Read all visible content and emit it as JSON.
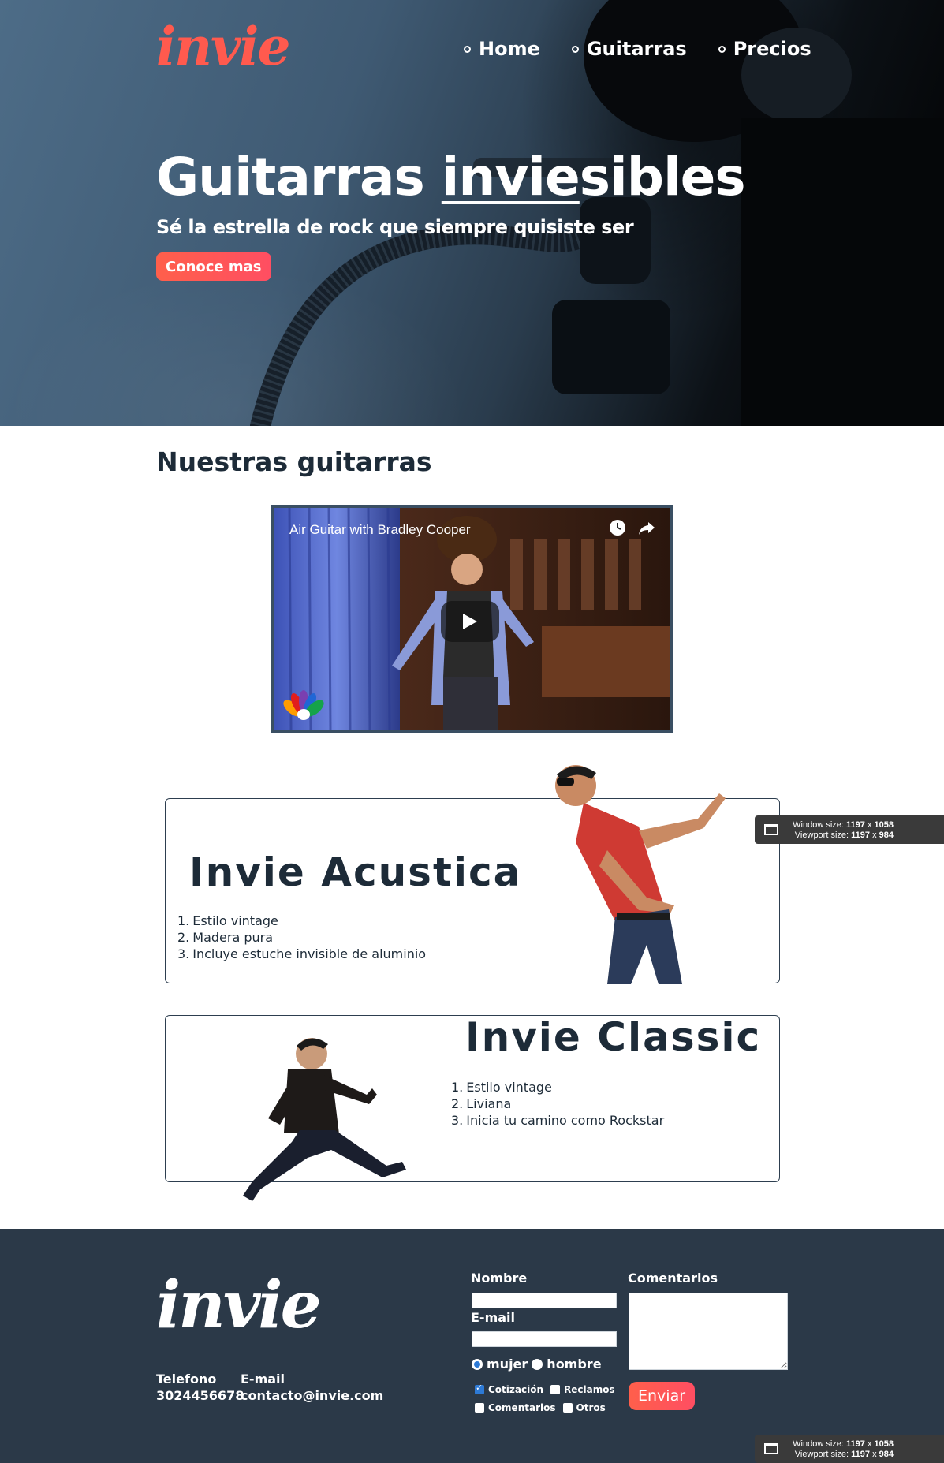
{
  "header": {
    "logo": "invie",
    "nav": [
      {
        "label": "Home"
      },
      {
        "label": "Guitarras"
      },
      {
        "label": "Precios"
      }
    ]
  },
  "hero": {
    "title_part1": "Guitarras ",
    "title_part2": "invie",
    "title_part3": "sibles",
    "subtitle": "Sé la estrella de rock que siempre quisiste ser",
    "cta_label": "Conoce mas"
  },
  "guitars_section": {
    "title": "Nuestras guitarras",
    "video": {
      "title": "Air Guitar with Bradley Cooper",
      "icons": [
        "clock-icon",
        "share-icon",
        "play-icon",
        "nbc-peacock-logo"
      ]
    }
  },
  "products": [
    {
      "name": "Invie Acustica",
      "features": [
        {
          "n": "1.",
          "text": "Estilo vintage"
        },
        {
          "n": "2.",
          "text": "Madera pura"
        },
        {
          "n": "3.",
          "text": "Incluye estuche invisible de aluminio"
        }
      ]
    },
    {
      "name": "Invie Classic",
      "features": [
        {
          "n": "1.",
          "text": "Estilo vintage"
        },
        {
          "n": "2.",
          "text": "Liviana"
        },
        {
          "n": "3.",
          "text": "Inicia tu camino como Rockstar"
        }
      ]
    }
  ],
  "footer": {
    "logo": "invie",
    "phone_label": "Telefono",
    "phone_value": "3024456678",
    "email_label": "E-mail",
    "email_value": "contacto@invie.com",
    "form": {
      "name_label": "Nombre",
      "email_label": "E-mail",
      "comments_label": "Comentarios",
      "gender_options": [
        "mujer",
        "hombre"
      ],
      "gender_selected": "mujer",
      "checkboxes": [
        {
          "label": "Cotización",
          "checked": true
        },
        {
          "label": "Reclamos",
          "checked": false
        },
        {
          "label": "Comentarios",
          "checked": false
        },
        {
          "label": "Otros",
          "checked": false
        }
      ],
      "submit_label": "Enviar"
    }
  },
  "size_overlay": {
    "window_label": "Window size:",
    "window_w": "1197",
    "window_h": "1058",
    "viewport_label": "Viewport size:",
    "viewport_w": "1197",
    "viewport_h": "984",
    "times": "x"
  },
  "colors": {
    "accent": "#ff5a4e",
    "dark": "#1d2b38",
    "footer_bg": "#2b3948",
    "check_blue": "#2d7ad6"
  }
}
